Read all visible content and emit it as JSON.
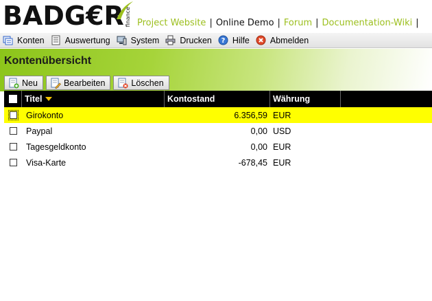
{
  "brand": {
    "logo_text": "BADG€R",
    "logo_sub": "finance",
    "accent_color": "#9cbf1e"
  },
  "toplinks": [
    {
      "label": "Project Website",
      "active": false
    },
    {
      "label": "Online Demo",
      "active": true
    },
    {
      "label": "Forum",
      "active": false
    },
    {
      "label": "Documentation-Wiki",
      "active": false
    }
  ],
  "menu": [
    {
      "label": "Konten",
      "icon": "accounts-icon"
    },
    {
      "label": "Auswertung",
      "icon": "report-icon"
    },
    {
      "label": "System",
      "icon": "system-icon"
    },
    {
      "label": "Drucken",
      "icon": "printer-icon"
    },
    {
      "label": "Hilfe",
      "icon": "help-icon"
    },
    {
      "label": "Abmelden",
      "icon": "logout-icon"
    }
  ],
  "page": {
    "title": "Kontenübersicht"
  },
  "toolbar": {
    "new_label": "Neu",
    "edit_label": "Bearbeiten",
    "delete_label": "Löschen"
  },
  "table": {
    "columns": [
      "Titel",
      "Kontostand",
      "Währung"
    ],
    "sort_column": "Titel",
    "rows": [
      {
        "titel": "Girokonto",
        "kontostand": "6.356,59",
        "waehrung": "EUR",
        "selected": true
      },
      {
        "titel": "Paypal",
        "kontostand": "0,00",
        "waehrung": "USD",
        "selected": false
      },
      {
        "titel": "Tagesgeldkonto",
        "kontostand": "0,00",
        "waehrung": "EUR",
        "selected": false
      },
      {
        "titel": "Visa-Karte",
        "kontostand": "-678,45",
        "waehrung": "EUR",
        "selected": false
      }
    ]
  }
}
